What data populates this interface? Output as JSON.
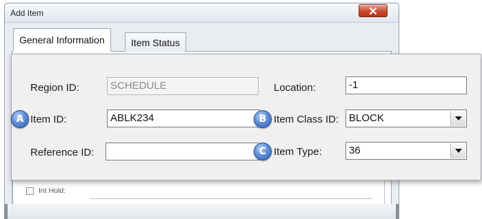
{
  "window": {
    "title": "Add Item",
    "close_icon": "close-icon"
  },
  "tabs": [
    {
      "label": "General Information",
      "active": true
    },
    {
      "label": "Item Status",
      "active": false
    }
  ],
  "form": {
    "region_id": {
      "label": "Region ID:",
      "value": "SCHEDULE",
      "disabled": true
    },
    "item_id": {
      "label": "Item ID:",
      "value": "ABLK234",
      "badge": "A"
    },
    "reference_id": {
      "label": "Reference ID:",
      "value": ""
    },
    "location": {
      "label": "Location:",
      "value": "-1"
    },
    "item_class_id": {
      "label": "Item Class ID:",
      "value": "BLOCK",
      "badge": "B"
    },
    "item_type": {
      "label": "Item Type:",
      "value": "36",
      "badge": "C"
    }
  },
  "int_hold": {
    "label": "Int Hold:",
    "checked": false
  },
  "colors": {
    "badge": "#4f7fcf",
    "close_button": "#c84a30"
  }
}
